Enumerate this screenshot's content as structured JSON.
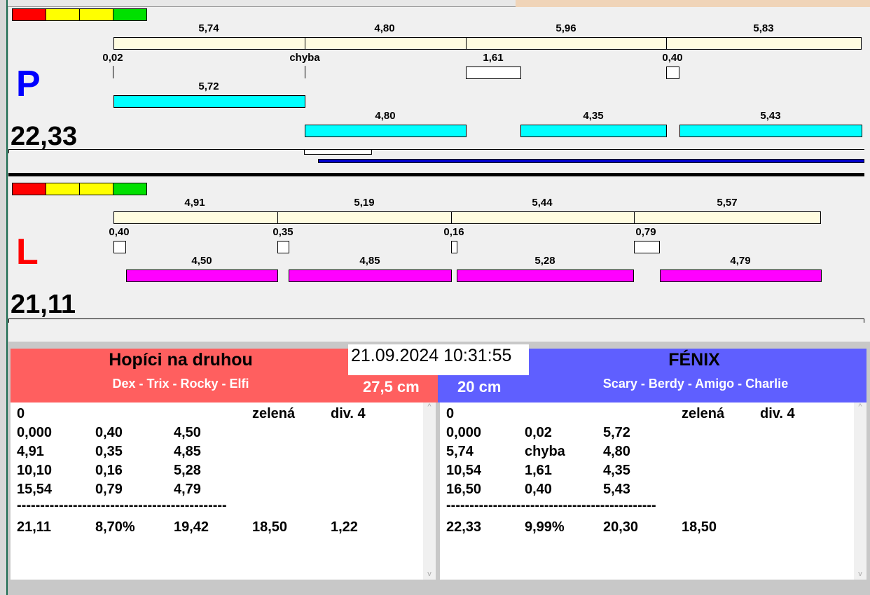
{
  "colors": {
    "legend": [
      "#ff0000",
      "#ffff00",
      "#ffff00",
      "#00e000"
    ],
    "p_color": "#0000ff",
    "l_color": "#ff0000",
    "red_team": "#ff5f5f",
    "blue_team": "#5f5fff"
  },
  "p": {
    "letter": "P",
    "total": "22,33",
    "top_labels": [
      "5,74",
      "4,80",
      "5,96",
      "5,83"
    ],
    "mid_labels": [
      "0,02",
      "chyba",
      "1,61",
      "0,40"
    ],
    "bottom_labels": [
      "5,72",
      "4,80",
      "4,35",
      "5,43"
    ]
  },
  "l": {
    "letter": "L",
    "total": "21,11",
    "top_labels": [
      "4,91",
      "5,19",
      "5,44",
      "5,57"
    ],
    "mid_labels": [
      "0,40",
      "0,35",
      "0,16",
      "0,79"
    ],
    "bottom_labels": [
      "4,50",
      "4,85",
      "5,28",
      "4,79"
    ]
  },
  "datetime": "21.09.2024 10:31:55",
  "left_team": {
    "name": "Hopíci na druhou",
    "dogs": "Dex - Trix - Rocky - Elfi",
    "size": "27,5 cm",
    "rows": [
      [
        "0",
        "",
        "",
        "zelená",
        "div. 4"
      ],
      [
        "0,000",
        "0,40",
        "4,50",
        "",
        ""
      ],
      [
        "4,91",
        "0,35",
        "4,85",
        "",
        ""
      ],
      [
        "10,10",
        "0,16",
        "5,28",
        "",
        ""
      ],
      [
        "15,54",
        "0,79",
        "4,79",
        "",
        ""
      ]
    ],
    "separator": "---------------------------------------------",
    "summary": [
      "21,11",
      "8,70%",
      "19,42",
      "18,50",
      "1,22"
    ]
  },
  "right_team": {
    "name": "FÉNIX",
    "dogs": "Scary - Berdy - Amigo - Charlie",
    "size": "20 cm",
    "rows": [
      [
        "0",
        "",
        "",
        "zelená",
        "div. 4"
      ],
      [
        "0,000",
        "0,02",
        "5,72",
        "",
        ""
      ],
      [
        "5,74",
        "chyba",
        "4,80",
        "",
        ""
      ],
      [
        "10,54",
        "1,61",
        "4,35",
        "",
        ""
      ],
      [
        "16,50",
        "0,40",
        "5,43",
        "",
        ""
      ]
    ],
    "separator": "---------------------------------------------",
    "summary": [
      "22,33",
      "9,99%",
      "20,30",
      "18,50",
      ""
    ]
  },
  "scroll": {
    "up": "^",
    "down": "v"
  }
}
